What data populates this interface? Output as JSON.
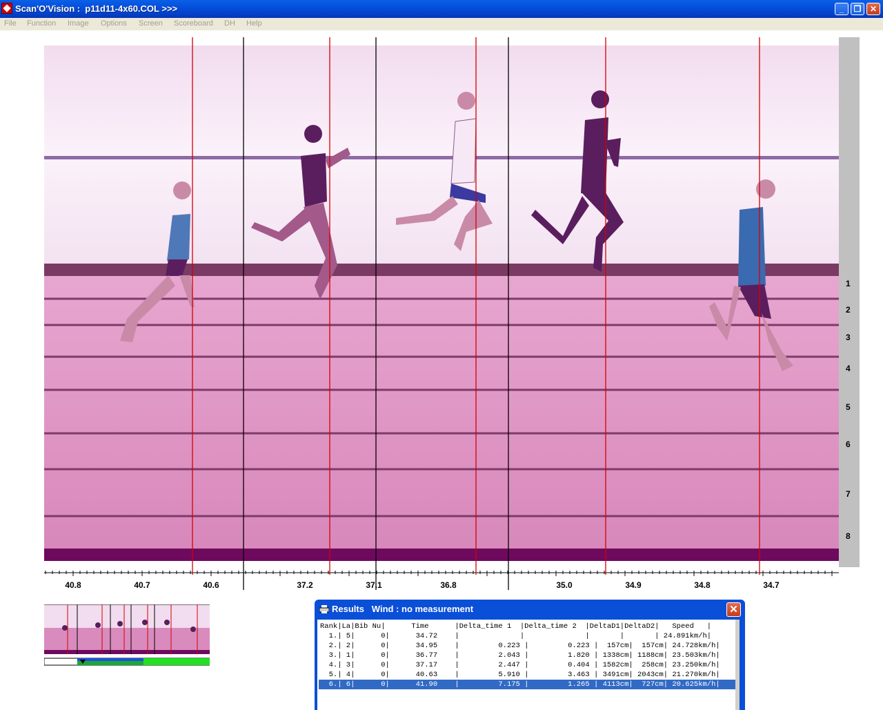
{
  "window": {
    "title": "Scan'O'Vision :  p11d11-4x60.COL >>>",
    "minimize": "_",
    "restore": "❐",
    "close": "✕"
  },
  "menu": [
    "File",
    "Function",
    "Image",
    "Options",
    "Screen",
    "Scoreboard",
    "DH",
    "Help"
  ],
  "lanes": [
    "1",
    "2",
    "3",
    "4",
    "5",
    "6",
    "7",
    "8"
  ],
  "axis_ticks": [
    "40.8",
    "40.7",
    "40.6",
    "37.2",
    "37.1",
    "36.8",
    "35.0",
    "34.9",
    "34.8",
    "34.7"
  ],
  "colors": {
    "track": "#d98bbd",
    "sky": "#f6e8f4",
    "rail": "#6a0a5a",
    "finish_line": "#d40000"
  },
  "results": {
    "title": "Results   Wind : no measurement",
    "icon": "printer-icon",
    "header": "Rank|La|Bib Nu|      Time      |Delta_time 1  |Delta_time 2  |DeltaD1|DeltaD2|   Speed   |",
    "rows": [
      "  1.| 5|      0|      34.72    |              |              |       |       | 24.891km/h|",
      "  2.| 2|      0|      34.95    |         0.223 |         0.223 |  157cm|  157cm| 24.728km/h|",
      "  3.| 1|      0|      36.77    |         2.043 |         1.820 | 1338cm| 1188cm| 23.503km/h|",
      "  4.| 3|      0|      37.17    |         2.447 |         0.404 | 1582cm|  258cm| 23.250km/h|",
      "  5.| 4|      0|      40.63    |         5.910 |         3.463 | 3491cm| 2043cm| 21.270km/h|",
      "  6.| 6|      0|      41.90    |         7.175 |         1.265 | 4113cm|  727cm| 20.625km/h|"
    ],
    "selected_row": 5
  }
}
